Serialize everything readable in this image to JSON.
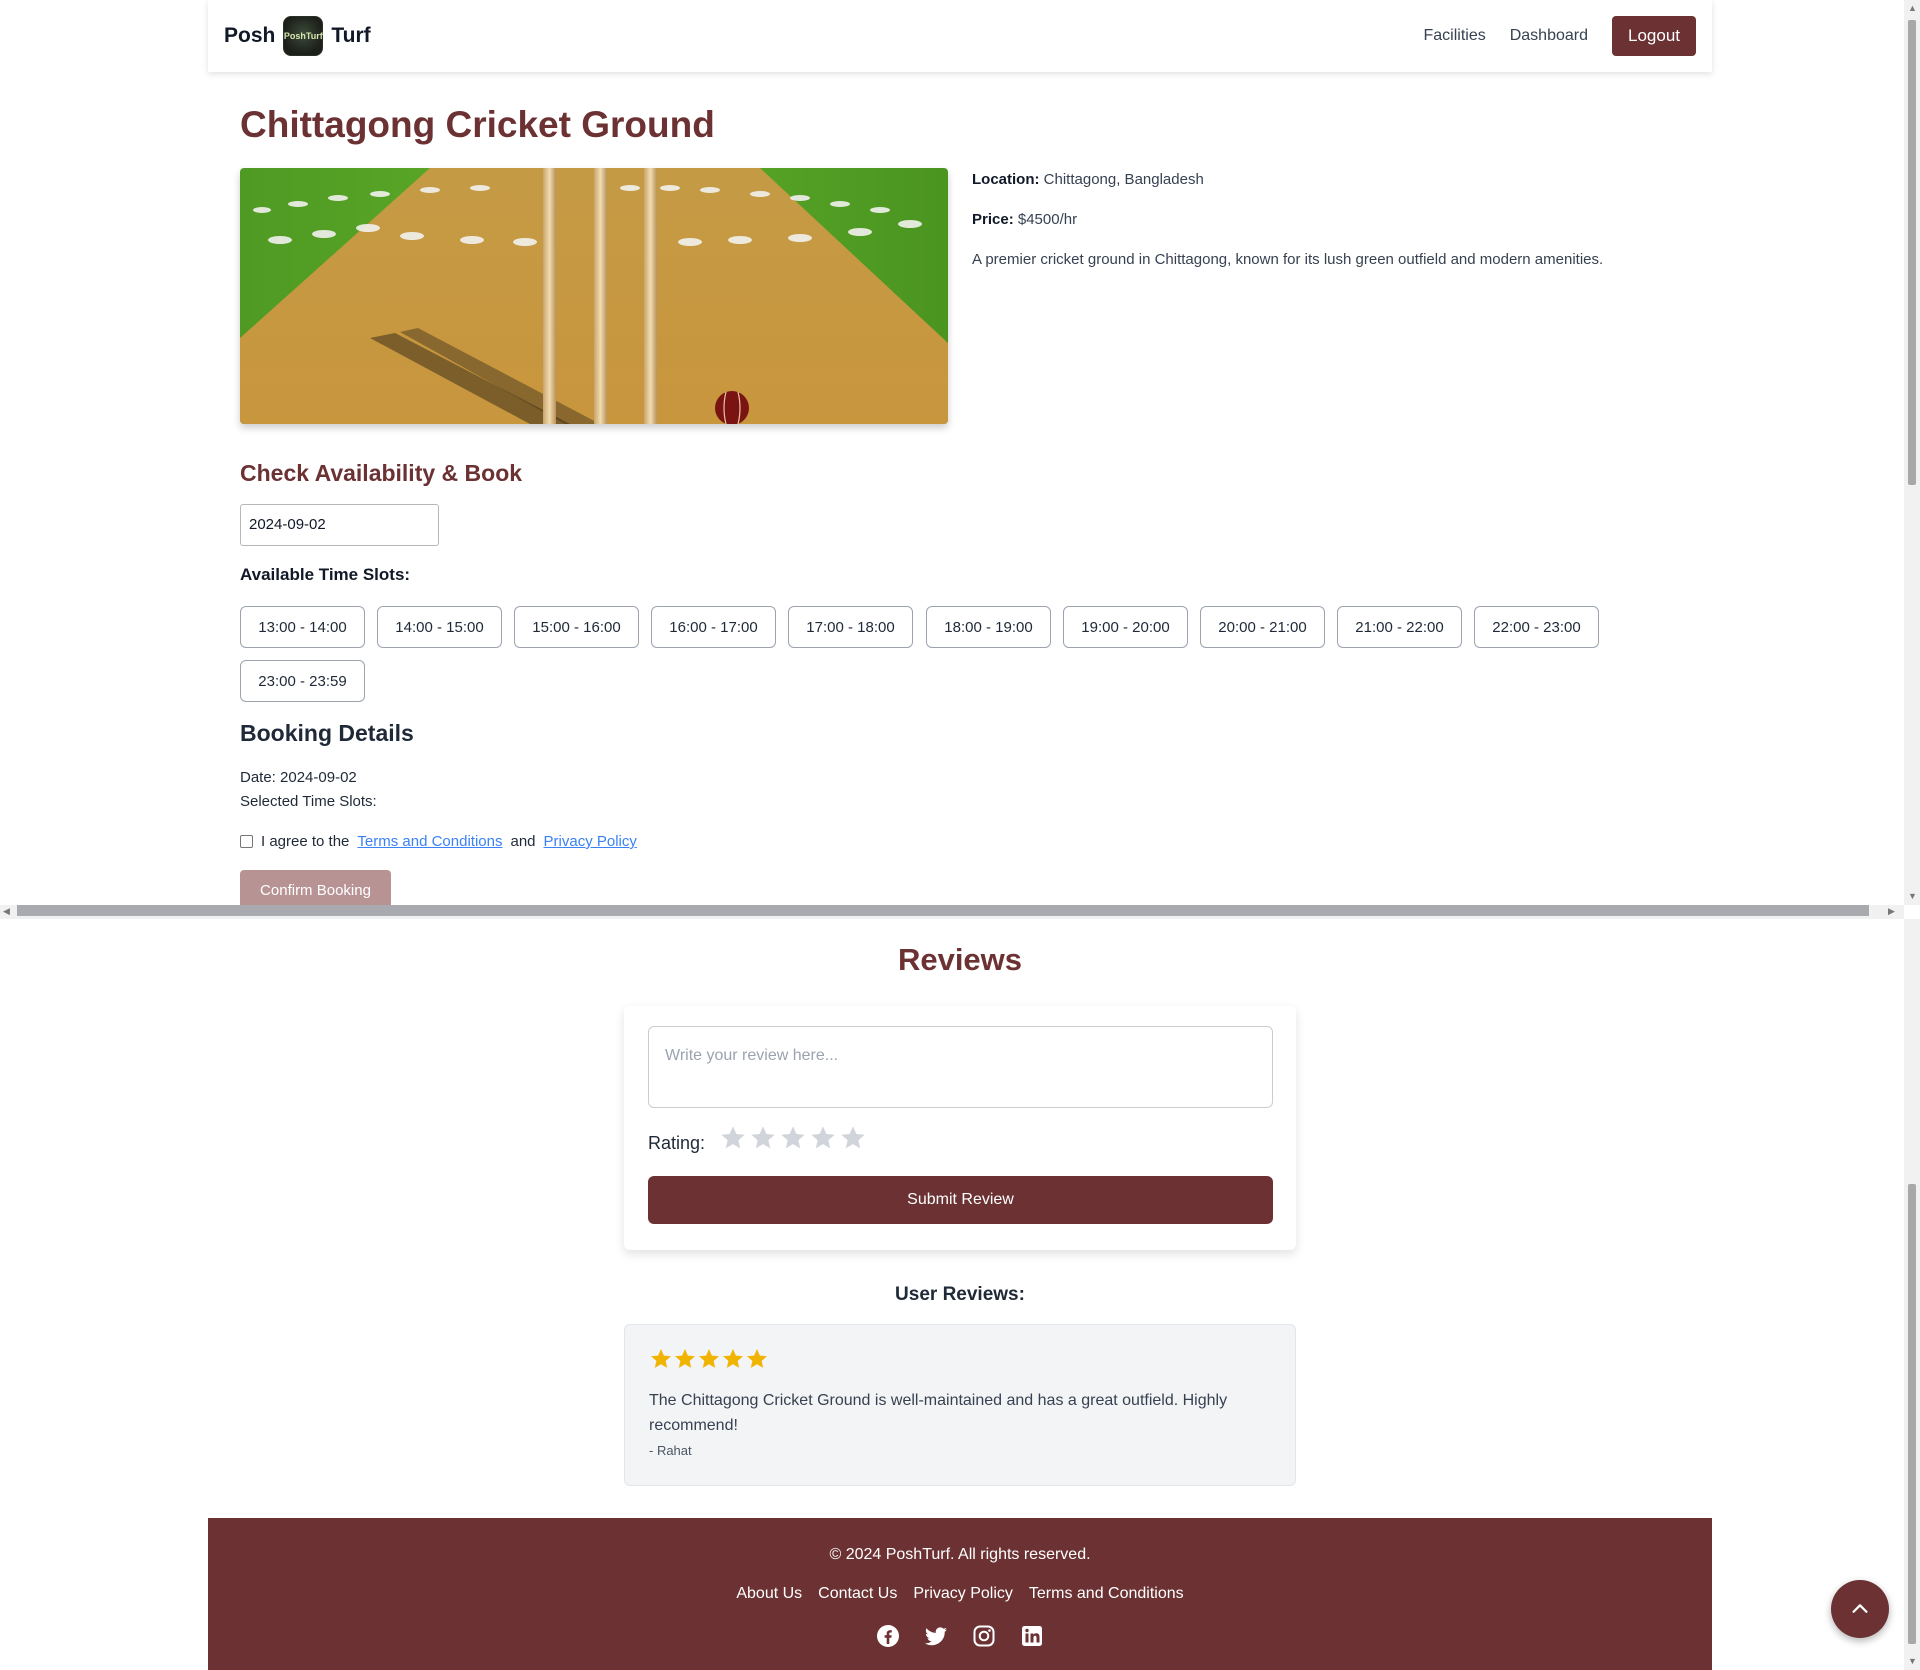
{
  "nav": {
    "brand_left": "Posh",
    "brand_logo_text": "PoshTurf",
    "brand_right": "Turf",
    "links": [
      "Facilities",
      "Dashboard"
    ],
    "logout": "Logout"
  },
  "facility": {
    "title": "Chittagong Cricket Ground",
    "location_label": "Location:",
    "location": "Chittagong, Bangladesh",
    "price_label": "Price:",
    "price": "$4500/hr",
    "description": "A premier cricket ground in Chittagong, known for its lush green outfield and modern amenities."
  },
  "availability": {
    "heading": "Check Availability & Book",
    "date_value": "2024-09-02",
    "slots_label": "Available Time Slots:",
    "slots": [
      "13:00 - 14:00",
      "14:00 - 15:00",
      "15:00 - 16:00",
      "16:00 - 17:00",
      "17:00 - 18:00",
      "18:00 - 19:00",
      "19:00 - 20:00",
      "20:00 - 21:00",
      "21:00 - 22:00",
      "22:00 - 23:00",
      "23:00 - 23:59"
    ]
  },
  "booking": {
    "heading": "Booking Details",
    "date_line": "Date: 2024-09-02",
    "slots_line": "Selected Time Slots:",
    "agree_prefix": "I agree to the",
    "terms": "Terms and Conditions",
    "and": "and",
    "privacy": "Privacy Policy",
    "confirm": "Confirm Booking"
  },
  "reviews": {
    "heading": "Reviews",
    "placeholder": "Write your review here...",
    "rating_label": "Rating:",
    "rating_value": 0,
    "rating_max": 5,
    "submit": "Submit Review",
    "user_heading": "User Reviews:",
    "items": [
      {
        "stars": 5,
        "text": "The Chittagong Cricket Ground is well-maintained and has a great outfield. Highly recommend!",
        "author": "- Rahat"
      }
    ]
  },
  "footer": {
    "copyright": "© 2024 PoshTurf. All rights reserved.",
    "links": [
      "About Us",
      "Contact Us",
      "Privacy Policy",
      "Terms and Conditions"
    ],
    "socials": [
      "facebook-icon",
      "twitter-icon",
      "instagram-icon",
      "linkedin-icon"
    ]
  },
  "colors": {
    "brand": "#6b3133",
    "star_filled": "#f0b400",
    "star_empty": "#d1d5db",
    "link": "#3b82f6"
  }
}
